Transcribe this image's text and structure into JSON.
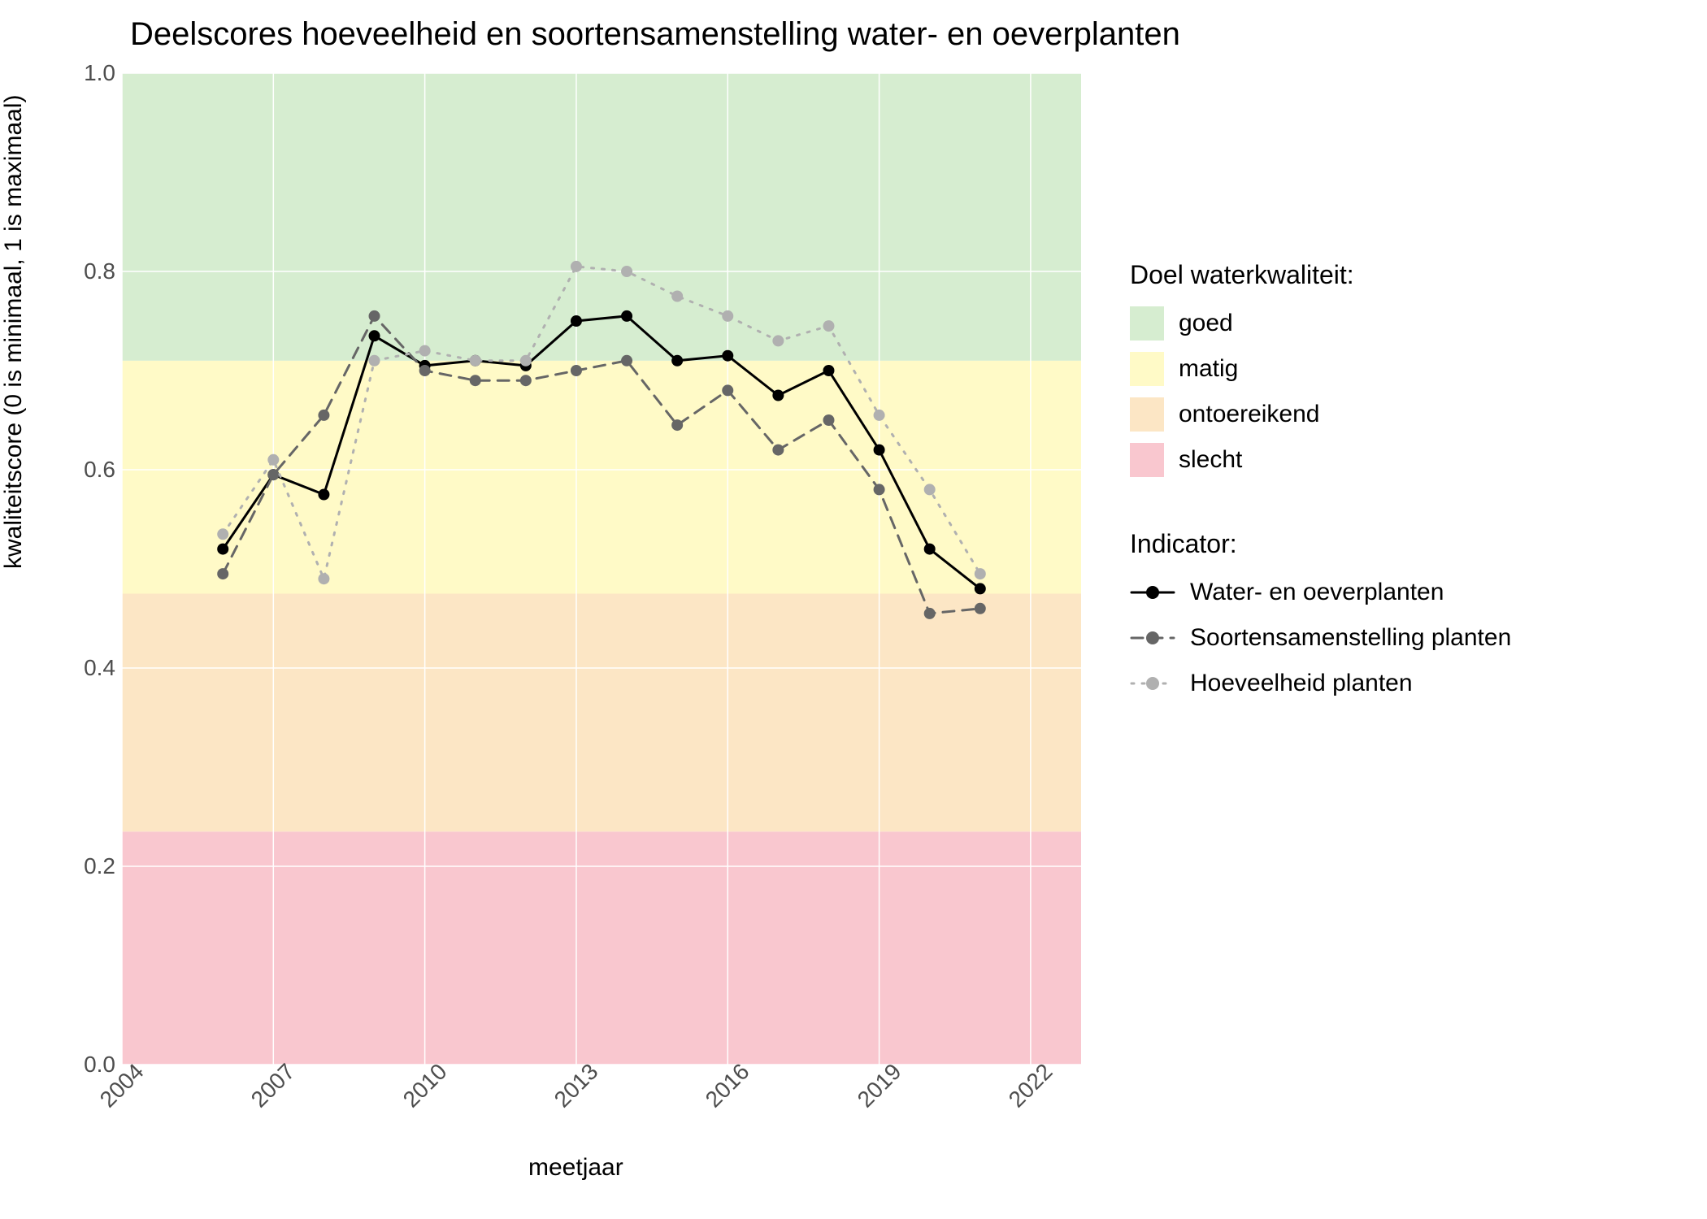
{
  "chart_data": {
    "type": "line",
    "title": "Deelscores hoeveelheid en soortensamenstelling water- en oeverplanten",
    "xlabel": "meetjaar",
    "ylabel": "kwaliteitscore (0 is minimaal, 1 is maximaal)",
    "xlim": [
      2004,
      2023
    ],
    "ylim": [
      0.0,
      1.0
    ],
    "x_ticks": [
      2004,
      2007,
      2010,
      2013,
      2016,
      2019,
      2022
    ],
    "y_ticks": [
      0.0,
      0.2,
      0.4,
      0.6,
      0.8,
      1.0
    ],
    "x": [
      2006,
      2007,
      2008,
      2009,
      2010,
      2011,
      2012,
      2013,
      2014,
      2015,
      2016,
      2017,
      2018,
      2019,
      2020,
      2021,
      2022
    ],
    "series": [
      {
        "name": "Water- en oeverplanten",
        "linestyle": "solid",
        "color": "#000000",
        "values": [
          0.52,
          0.595,
          0.575,
          0.735,
          0.705,
          0.71,
          0.705,
          0.75,
          0.755,
          0.71,
          0.715,
          0.675,
          0.7,
          0.62,
          0.52,
          0.48,
          null
        ]
      },
      {
        "name": "Soortensamenstelling planten",
        "linestyle": "dashed",
        "color": "#666666",
        "values": [
          0.495,
          0.595,
          0.655,
          0.755,
          0.7,
          0.69,
          0.69,
          0.7,
          0.71,
          0.645,
          0.68,
          0.62,
          0.65,
          0.58,
          0.455,
          0.46,
          null
        ]
      },
      {
        "name": "Hoeveelheid planten",
        "linestyle": "dotted",
        "color": "#b0b0b0",
        "values": [
          0.535,
          0.61,
          0.49,
          0.71,
          0.72,
          0.71,
          0.71,
          0.805,
          0.8,
          0.775,
          0.755,
          0.73,
          0.745,
          0.655,
          0.58,
          0.495,
          null
        ]
      }
    ],
    "bands": [
      {
        "name": "slecht",
        "ymin": 0.0,
        "ymax": 0.235,
        "color": "#f9c7cf"
      },
      {
        "name": "ontoereikend",
        "ymin": 0.235,
        "ymax": 0.475,
        "color": "#fce6c5"
      },
      {
        "name": "matig",
        "ymin": 0.475,
        "ymax": 0.71,
        "color": "#fffac7"
      },
      {
        "name": "goed",
        "ymin": 0.71,
        "ymax": 1.0,
        "color": "#d6edd0"
      }
    ],
    "legend_title_bands": "Doel waterkwaliteit:",
    "legend_title_series": "Indicator:"
  }
}
